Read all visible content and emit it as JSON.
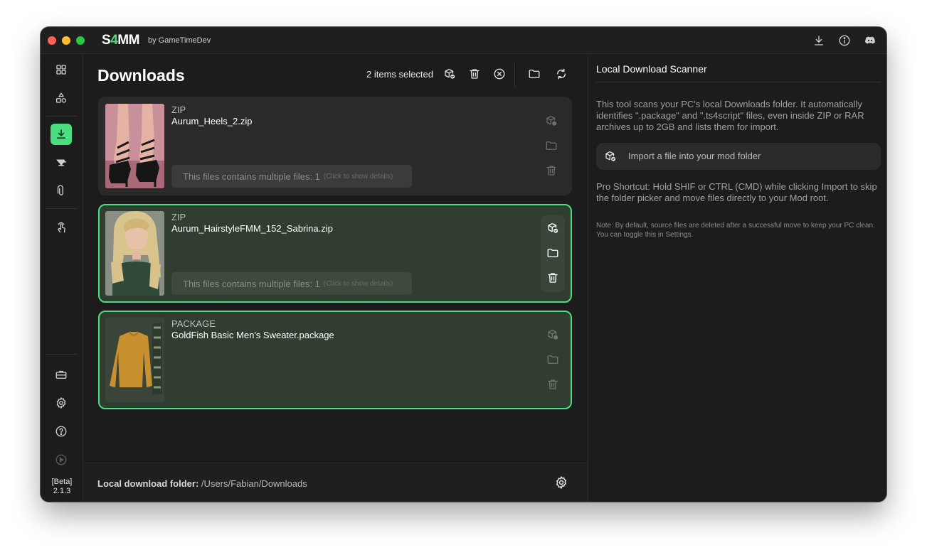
{
  "app": {
    "logo_main": "S4MM",
    "byline": "by GameTimeDev",
    "version_label": "[Beta]",
    "version_number": "2.1.3"
  },
  "titlebar": {
    "icons": [
      "download-icon",
      "info-icon",
      "discord-icon"
    ]
  },
  "sidebar": {
    "items": [
      {
        "name": "dashboard",
        "icon": "grid-icon",
        "active": false
      },
      {
        "name": "shapes",
        "icon": "shapes-icon",
        "active": false
      },
      {
        "name": "downloads",
        "icon": "download-icon",
        "active": true
      },
      {
        "name": "tools",
        "icon": "anvil-icon",
        "active": false
      },
      {
        "name": "attachments",
        "icon": "paperclip-icon",
        "active": false
      },
      {
        "name": "touch",
        "icon": "touch-icon",
        "active": false
      }
    ],
    "bottom_items": [
      {
        "name": "toolbox",
        "icon": "briefcase-icon"
      },
      {
        "name": "settings",
        "icon": "gear-icon"
      },
      {
        "name": "help",
        "icon": "help-icon"
      },
      {
        "name": "play",
        "icon": "play-icon"
      }
    ]
  },
  "main": {
    "title": "Downloads",
    "selection_text": "2 items selected",
    "files": [
      {
        "type": "ZIP",
        "name": "Aurum_Heels_2.zip",
        "multi_text": "This files contains multiple files: 1",
        "multi_hint": "(Click to show details)",
        "selected": false,
        "thumb": "heels"
      },
      {
        "type": "ZIP",
        "name": "Aurum_HairstyleFMM_152_Sabrina.zip",
        "multi_text": "This files contains multiple files: 1",
        "multi_hint": "(Click to show details)",
        "selected": true,
        "thumb": "hairstyle"
      },
      {
        "type": "PACKAGE",
        "name": "GoldFish Basic Men's Sweater.package",
        "selected": true,
        "thumb": "sweater"
      }
    ],
    "footer_label": "Local download folder:",
    "footer_path": " /Users/Fabian/Downloads"
  },
  "scanner": {
    "title": "Local Download Scanner",
    "description": "This tool scans your PC's local Downloads folder. It automatically identifies \".package\" and \".ts4script\" files, even inside ZIP or RAR archives up to 2GB and lists them for import.",
    "import_label": "Import a file into your mod folder",
    "pro_tip": "Pro Shortcut: Hold SHIF or CTRL (CMD) while clicking Import to skip the folder picker and move files directly to your Mod root.",
    "note": "Note: By default, source files are deleted after a successful move to keep your PC clean. You can toggle this in Settings."
  },
  "colors": {
    "accent": "#4ade80",
    "background": "#1c1c1c",
    "card": "#2a2a2a",
    "card_selected": "#303d30"
  }
}
